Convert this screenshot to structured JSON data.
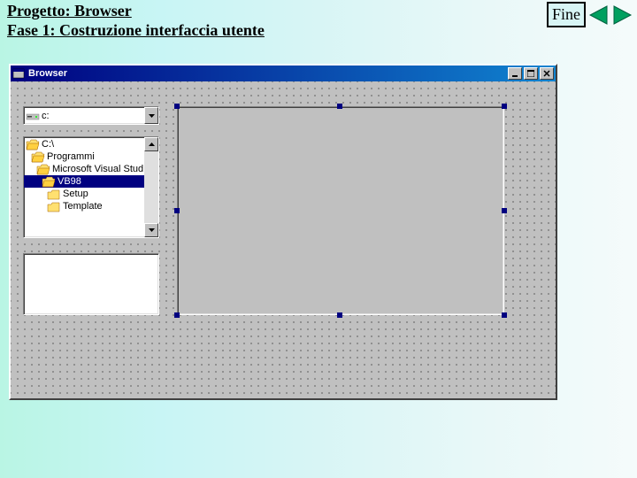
{
  "header": {
    "project_label": "Progetto: Browser",
    "phase_label": "Fase 1: Costruzione interfaccia utente"
  },
  "nav": {
    "fine_label": "Fine"
  },
  "window": {
    "title": "Browser",
    "drive": {
      "selected": "c:"
    },
    "directories": [
      {
        "label": "C:\\",
        "indent": 0,
        "open": true,
        "selected": false
      },
      {
        "label": "Programmi",
        "indent": 1,
        "open": true,
        "selected": false
      },
      {
        "label": "Microsoft Visual Stud",
        "indent": 2,
        "open": true,
        "selected": false
      },
      {
        "label": "VB98",
        "indent": 3,
        "open": true,
        "selected": true
      },
      {
        "label": "Setup",
        "indent": 4,
        "open": false,
        "selected": false
      },
      {
        "label": "Template",
        "indent": 4,
        "open": false,
        "selected": false
      }
    ]
  }
}
